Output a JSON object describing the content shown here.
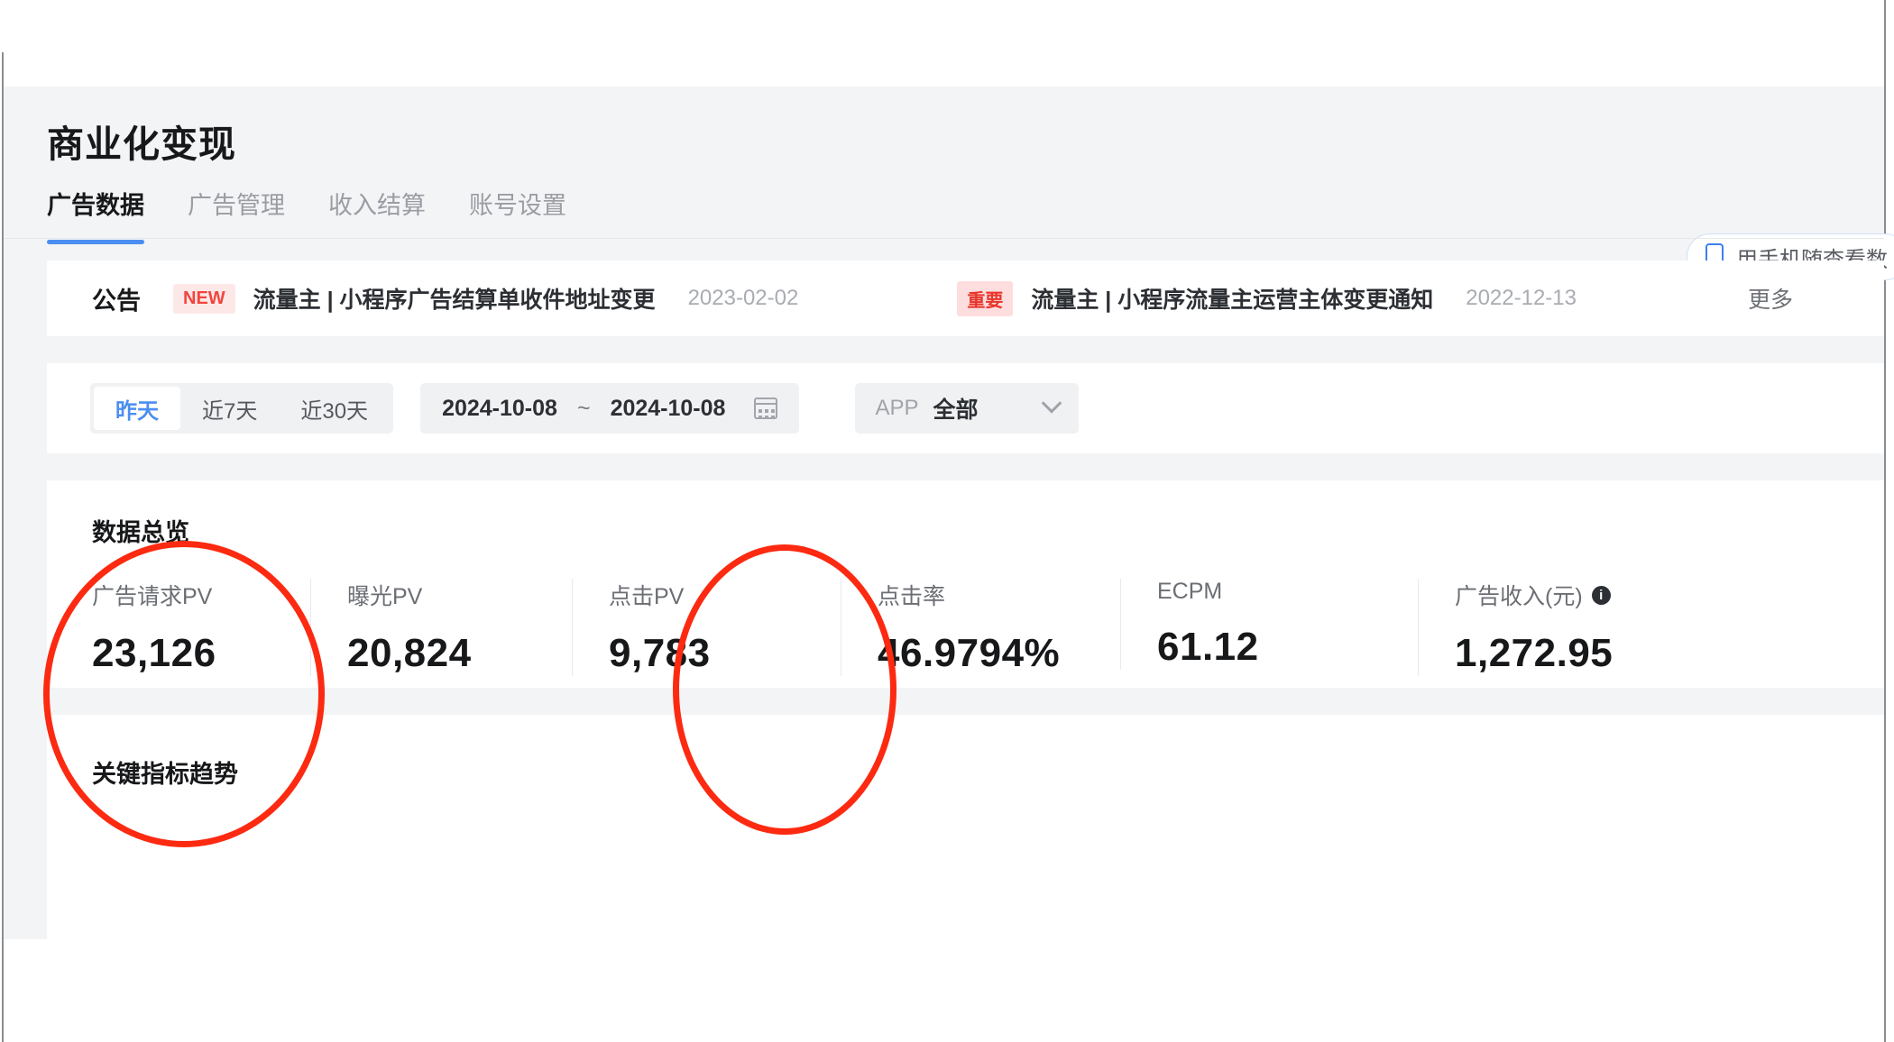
{
  "header": {
    "title": "商业化变现",
    "mobile_button": {
      "label": "用手机随查看数",
      "icon": "phone-icon"
    }
  },
  "tabs": [
    {
      "label": "广告数据",
      "active": true
    },
    {
      "label": "广告管理",
      "active": false
    },
    {
      "label": "收入结算",
      "active": false
    },
    {
      "label": "账号设置",
      "active": false
    }
  ],
  "announcement": {
    "label": "公告",
    "more_label": "更多",
    "items": [
      {
        "badge": "NEW",
        "badge_color": "#f1453d",
        "text": "流量主 | 小程序广告结算单收件地址变更",
        "date": "2023-02-02"
      },
      {
        "badge": "重要",
        "badge_color": "#e8342a",
        "text": "流量主 | 小程序流量主运营主体变更通知",
        "date": "2022-12-13"
      }
    ]
  },
  "filters": {
    "ranges": [
      {
        "label": "昨天",
        "active": true
      },
      {
        "label": "近7天",
        "active": false
      },
      {
        "label": "近30天",
        "active": false
      }
    ],
    "date_start": "2024-10-08",
    "date_separator": "~",
    "date_end": "2024-10-08",
    "calendar_icon": "calendar-icon",
    "app_label": "APP",
    "app_value": "全部",
    "chevron_icon": "chevron-down-icon"
  },
  "overview": {
    "title": "数据总览",
    "metrics": [
      {
        "label": "广告请求PV",
        "value": "23,126",
        "info": false
      },
      {
        "label": "曝光PV",
        "value": "20,824",
        "info": false
      },
      {
        "label": "点击PV",
        "value": "9,783",
        "info": false
      },
      {
        "label": "点击率",
        "value": "46.9794%",
        "info": false
      },
      {
        "label": "ECPM",
        "value": "61.12",
        "info": false
      },
      {
        "label": "广告收入(元)",
        "value": "1,272.95",
        "info": true
      }
    ]
  },
  "trends": {
    "title": "关键指标趋势"
  },
  "annotations": {
    "accent_color": "#fc2a11",
    "shapes": [
      {
        "name": "highlight-ad-request-pv",
        "type": "ellipse"
      },
      {
        "name": "highlight-click-pv",
        "type": "ellipse"
      }
    ]
  }
}
